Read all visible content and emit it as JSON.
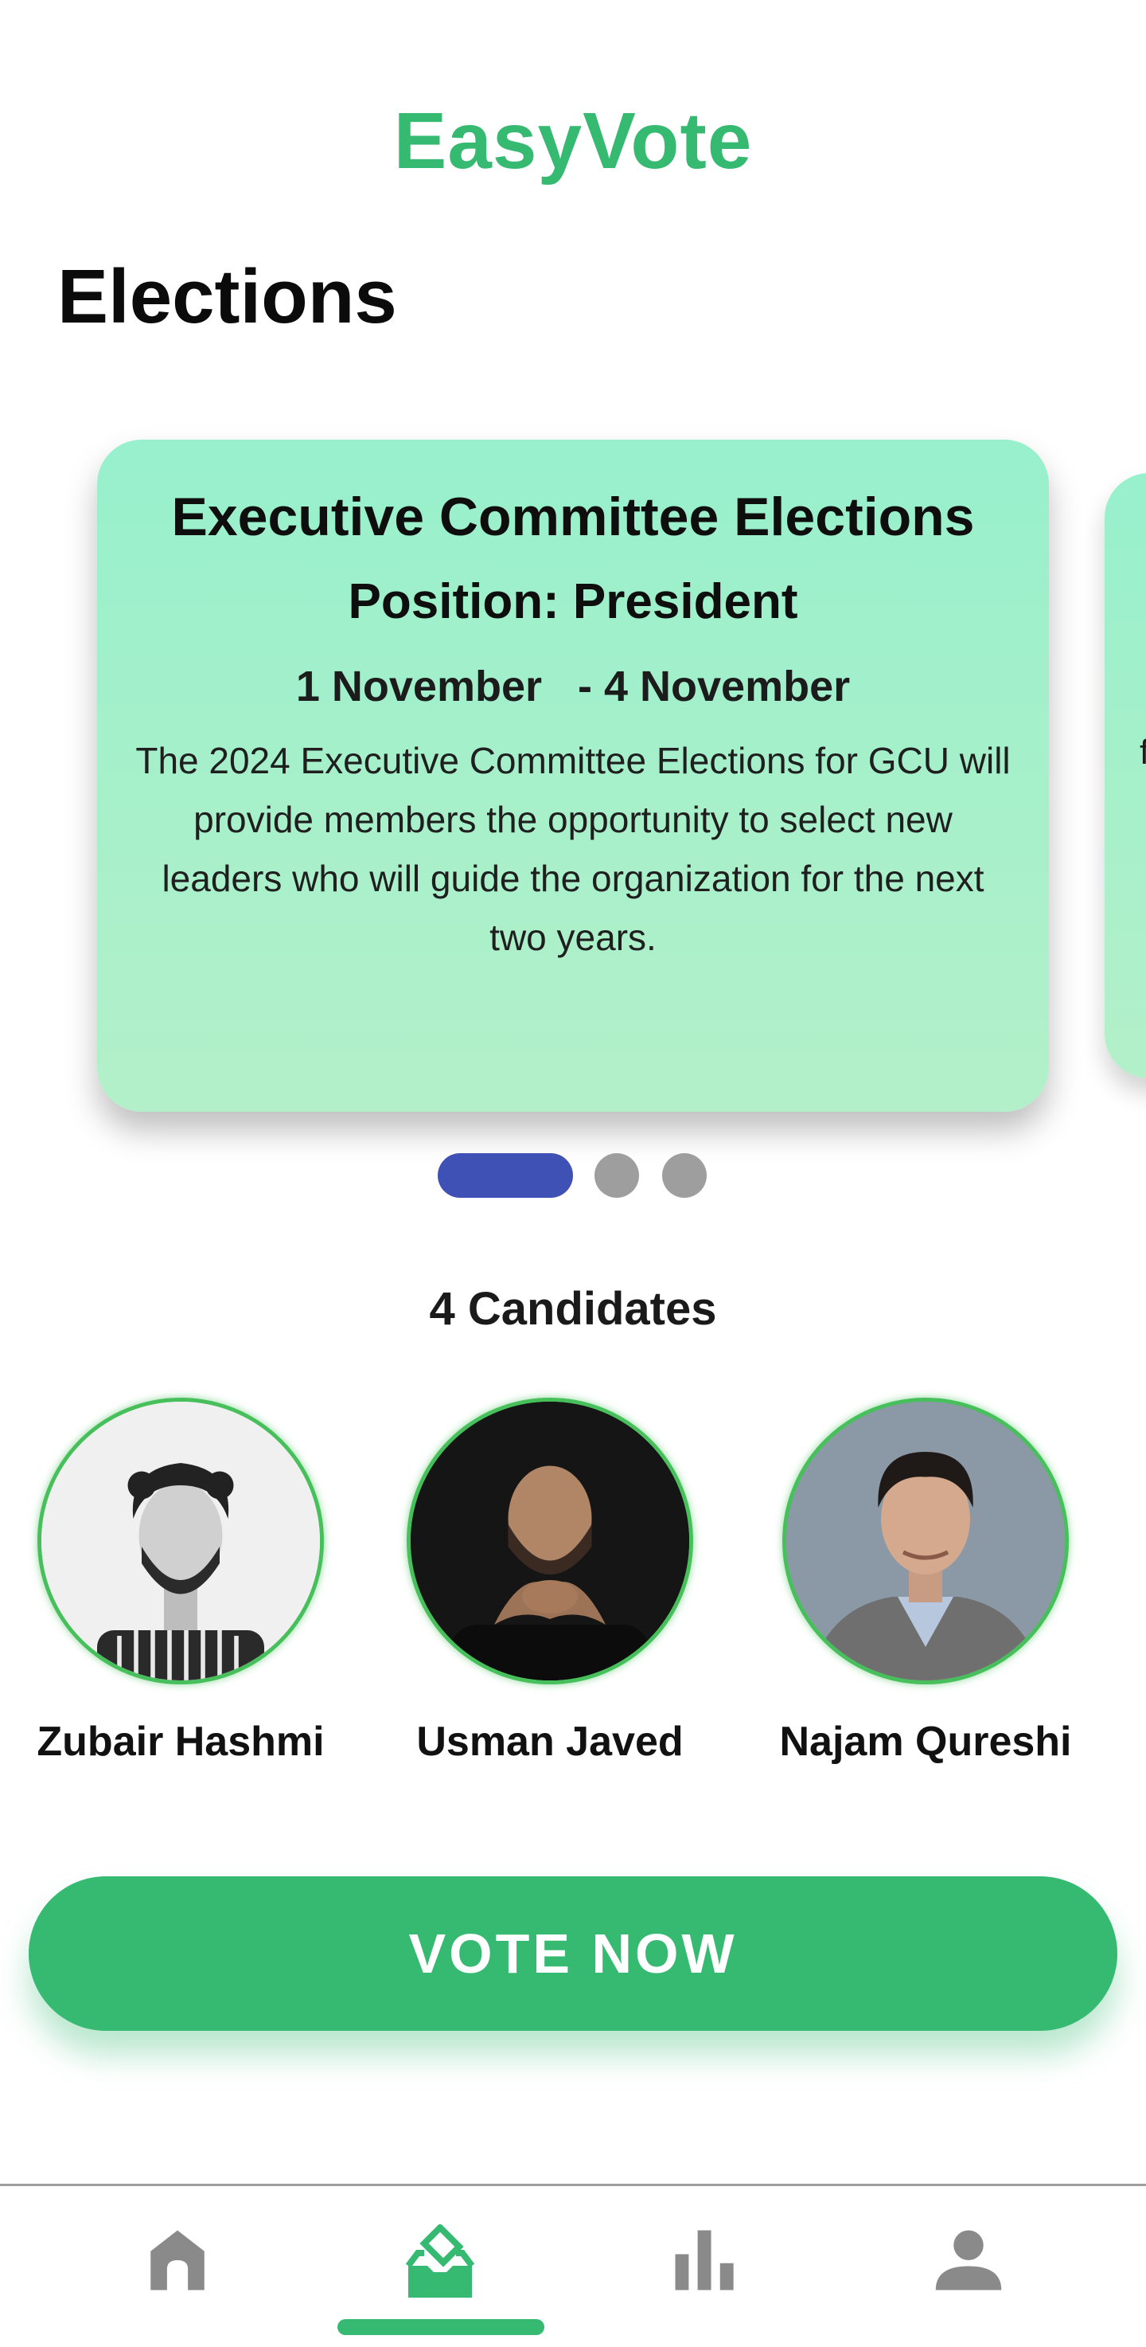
{
  "colors": {
    "brand": "#36ba72",
    "card_top": "#98f0cc",
    "card_bottom": "#b3f0c9",
    "dot_active": "#3f51b5",
    "dot_inactive": "#9e9e9e",
    "avatar_ring": "#47c05c",
    "nav_inactive": "#8a8a8a"
  },
  "header": {
    "brand": "EasyVote",
    "page_title": "Elections"
  },
  "carousel": {
    "active_index": 0,
    "total": 3,
    "cards": [
      {
        "title": "Executive Committee Elections",
        "position": "Position: President",
        "start_date": "1 November",
        "end_date": "- 4 November",
        "description": "The 2024 Executive Committee Elections for GCU will provide members the opportunity to select new leaders who will guide the organization for the next two years."
      }
    ],
    "next_peek": "f"
  },
  "candidates": {
    "count_label": "4 Candidates",
    "items": [
      {
        "name": "Zubair Hashmi"
      },
      {
        "name": "Usman Javed"
      },
      {
        "name": "Najam Qureshi"
      }
    ]
  },
  "actions": {
    "vote_label": "VOTE NOW"
  },
  "bottom_nav": {
    "active": "vote",
    "items": [
      {
        "id": "home",
        "icon": "home-icon"
      },
      {
        "id": "vote",
        "icon": "ballot-box-icon"
      },
      {
        "id": "results",
        "icon": "bar-chart-icon"
      },
      {
        "id": "profile",
        "icon": "person-icon"
      }
    ]
  }
}
